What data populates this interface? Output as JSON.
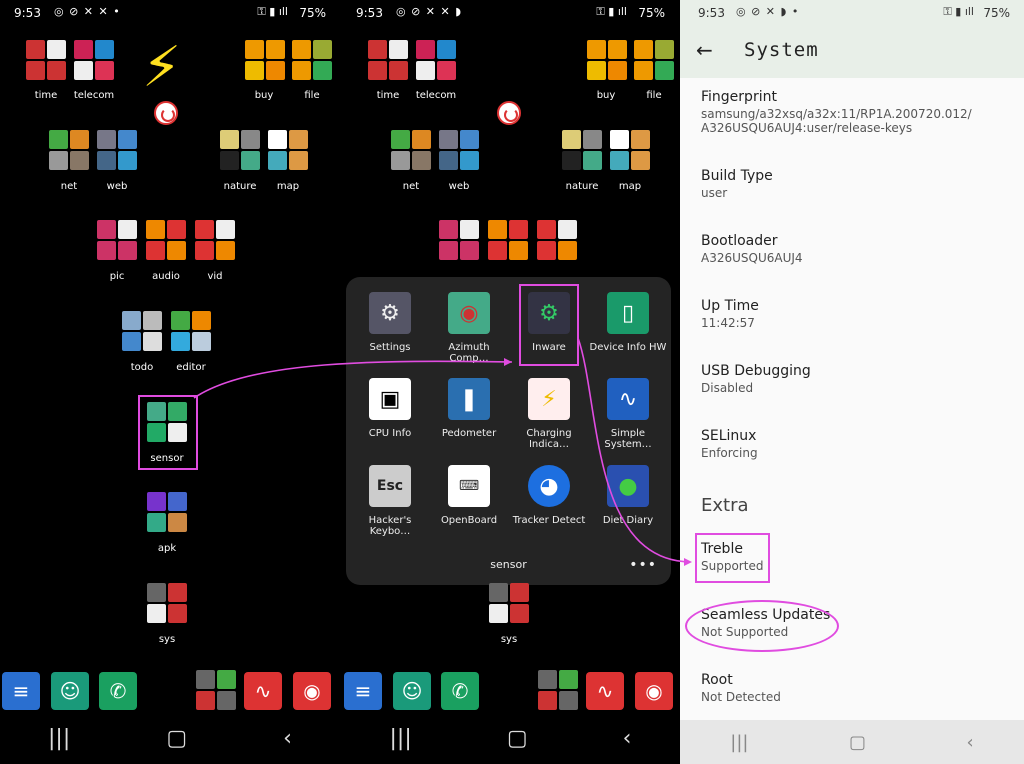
{
  "status": {
    "time": "9:53",
    "battery": "75%"
  },
  "home": {
    "folders": [
      "time",
      "telecom",
      "buy",
      "file",
      "net",
      "web",
      "nature",
      "map",
      "pic",
      "audio",
      "vid",
      "todo",
      "editor",
      "sensor",
      "apk",
      "sys"
    ],
    "second_folders": [
      "time",
      "telecom",
      "buy",
      "file",
      "net",
      "web",
      "nature",
      "map",
      "sys"
    ]
  },
  "popup": {
    "title": "sensor",
    "apps": [
      {
        "label": "Settings",
        "icon": "gear-icon"
      },
      {
        "label": "Azimuth Comp…",
        "icon": "compass-icon"
      },
      {
        "label": "Inware",
        "icon": "chip-icon"
      },
      {
        "label": "Device Info HW",
        "icon": "phone-icon"
      },
      {
        "label": "CPU Info",
        "icon": "cpu-icon"
      },
      {
        "label": "Pedometer",
        "icon": "footprint-icon"
      },
      {
        "label": "Charging Indica…",
        "icon": "bolt-icon"
      },
      {
        "label": "Simple System…",
        "icon": "pulse-icon"
      },
      {
        "label": "Hacker's Keybo…",
        "icon": "esc-key-icon"
      },
      {
        "label": "OpenBoard",
        "icon": "keyboard-icon"
      },
      {
        "label": "Tracker Detect",
        "icon": "globe-icon"
      },
      {
        "label": "Diet Diary",
        "icon": "apple-icon"
      }
    ]
  },
  "settings": {
    "title": "System",
    "rows": [
      {
        "key": "Fingerprint",
        "value": "samsung/a32xsq/a32x:11/RP1A.200720.012/\nA326USQU6AUJ4:user/release-keys"
      },
      {
        "key": "Build Type",
        "value": "user"
      },
      {
        "key": "Bootloader",
        "value": "A326USQU6AUJ4"
      },
      {
        "key": "Up Time",
        "value": "11:42:57"
      },
      {
        "key": "USB Debugging",
        "value": "Disabled"
      },
      {
        "key": "SELinux",
        "value": "Enforcing"
      }
    ],
    "section": "Extra",
    "extra": [
      {
        "key": "Treble",
        "value": "Supported"
      },
      {
        "key": "Seamless Updates",
        "value": "Not Supported"
      },
      {
        "key": "Root",
        "value": "Not Detected"
      }
    ]
  },
  "colors": {
    "highlight": "#e04ce0"
  }
}
